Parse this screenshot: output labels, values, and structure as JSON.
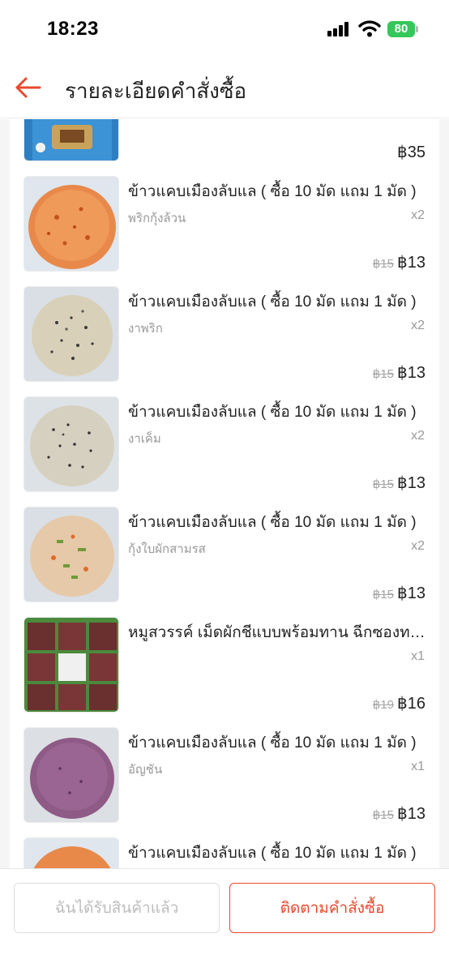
{
  "status_bar": {
    "time": "18:23",
    "battery": "80"
  },
  "header": {
    "title": "รายละเอียดคำสั่งซื้อ"
  },
  "first_item": {
    "price": "฿35"
  },
  "items": [
    {
      "title": "ข้าวแคบเมืองลับแล  ( ซื้อ 10 มัด แถม 1 มัด )",
      "variant": "พริกกุ้งล้วน",
      "qty": "x2",
      "old_price": "฿15",
      "price": "฿13"
    },
    {
      "title": "ข้าวแคบเมืองลับแล  ( ซื้อ 10 มัด แถม 1 มัด )",
      "variant": "งาพริก",
      "qty": "x2",
      "old_price": "฿15",
      "price": "฿13"
    },
    {
      "title": "ข้าวแคบเมืองลับแล  ( ซื้อ 10 มัด แถม 1 มัด )",
      "variant": "งาเค็ม",
      "qty": "x2",
      "old_price": "฿15",
      "price": "฿13"
    },
    {
      "title": "ข้าวแคบเมืองลับแล  ( ซื้อ 10 มัด แถม 1 มัด )",
      "variant": "กุ้งใบผักสามรส",
      "qty": "x2",
      "old_price": "฿15",
      "price": "฿13"
    },
    {
      "title": "หมูสวรรค์ เม็ดผักชีแบบพร้อมทาน ฉีกซองทานได้เลย",
      "variant": "",
      "qty": "x1",
      "old_price": "฿19",
      "price": "฿16"
    },
    {
      "title": "ข้าวแคบเมืองลับแล  ( ซื้อ 10 มัด แถม 1 มัด )",
      "variant": "อัญชัน",
      "qty": "x1",
      "old_price": "฿15",
      "price": "฿13"
    },
    {
      "title": "ข้าวแคบเมืองลับแล  ( ซื้อ 10 มัด แถม 1 มัด )",
      "variant": "",
      "qty": "",
      "old_price": "",
      "price": ""
    }
  ],
  "footer": {
    "received_label": "ฉันได้รับสินค้าแล้ว",
    "track_label": "ติดตามคำสั่งซื้อ"
  },
  "colors": {
    "accent": "#e8492e",
    "battery": "#34c759"
  }
}
